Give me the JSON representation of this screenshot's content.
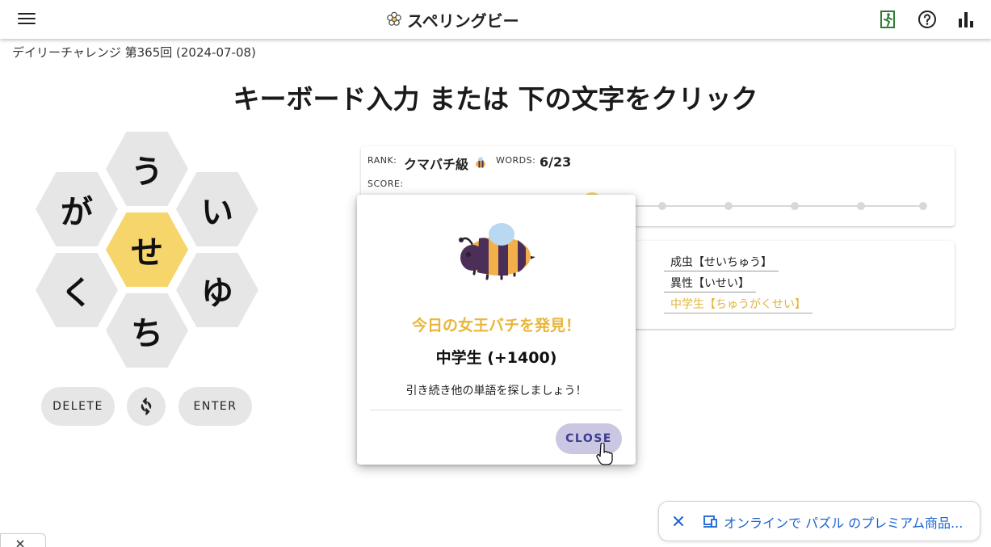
{
  "header": {
    "title": "スペリングビー",
    "icons": [
      "menu-icon",
      "flower-icon",
      "exit-icon",
      "help-icon",
      "stats-icon"
    ]
  },
  "daily_label": "デイリーチャレンジ 第365回 (2024-07-08)",
  "instruction": "キーボード入力 または 下の文字をクリック",
  "hive": {
    "center": "せ",
    "outer": [
      "う",
      "が",
      "い",
      "く",
      "ゆ",
      "ち"
    ]
  },
  "controls": {
    "delete_label": "DELETE",
    "shuffle_icon": "shuffle-icon",
    "enter_label": "ENTER"
  },
  "status": {
    "rank_label": "RANK:",
    "rank_value": "クマバチ級",
    "words_label": "WORDS:",
    "words_value": "6/23",
    "score_label": "SCORE:"
  },
  "found_words": [
    "成虫【せいちゅう】",
    "異性【いせい】",
    "中学生【ちゅうがくせい】"
  ],
  "modal": {
    "title": "今日の女王バチを発見！",
    "word": "中学生 (+1400)",
    "message": "引き続き他の単語を探しましょう！",
    "close_label": "CLOSE"
  },
  "promo": {
    "text": "オンラインで パズル のプレミアム商品..."
  },
  "colors": {
    "center_hex": "#f6d56a",
    "outer_hex": "#e6e6e6",
    "modal_title": "#e8b63a",
    "close_button": "#c9c7e2",
    "promo_link": "#1a62cf"
  }
}
